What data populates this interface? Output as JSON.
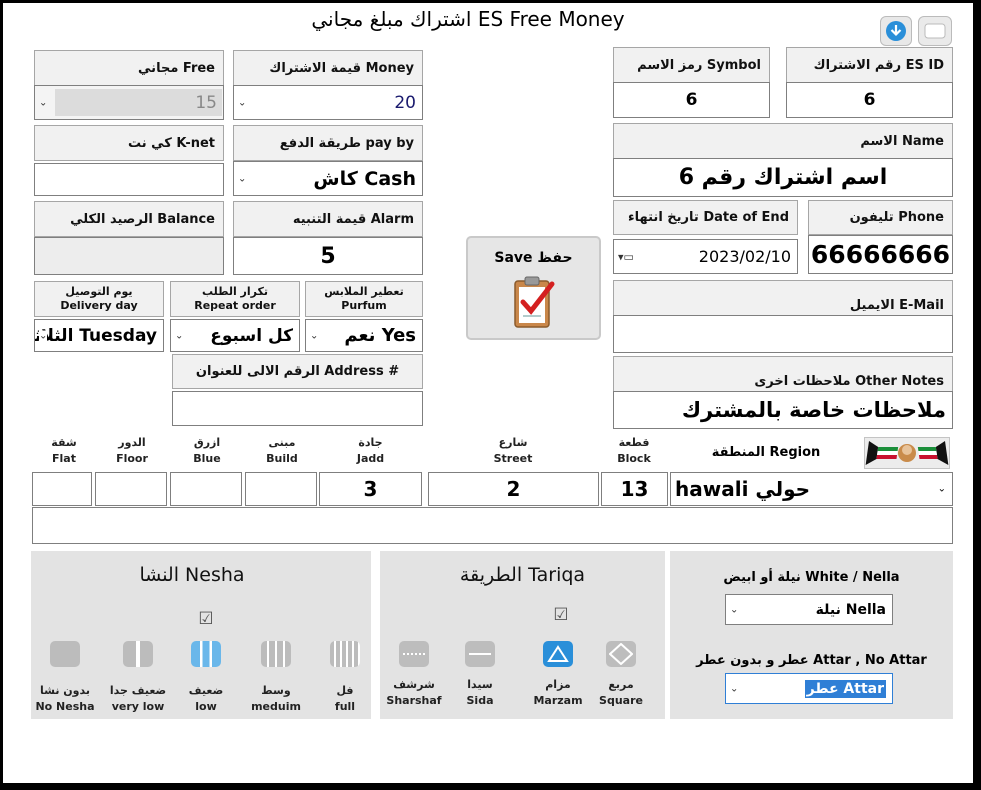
{
  "title": "اشتراك مبلغ مجاني  ES Free Money",
  "fields": {
    "es_id": {
      "label": "رقم الاشتراك ES ID",
      "value": "6"
    },
    "symbol": {
      "label": "رمز الاسم Symbol",
      "value": "6"
    },
    "money": {
      "label": "قيمة الاشتراك  Money",
      "value": "20"
    },
    "free": {
      "label": "مجاني Free",
      "value": "15"
    },
    "name": {
      "label": "الاسم  Name",
      "value": "اسم اشتراك رقم 6"
    },
    "pay_by": {
      "label": "طريقة الدفع pay by",
      "value": "كاش Cash"
    },
    "knet": {
      "label": "كي نت K-net",
      "value": ""
    },
    "phone": {
      "label": "تليفون  Phone",
      "value": "66666666"
    },
    "date_end": {
      "label": "تاريخ انتهاء Date of End",
      "value": "2023/02/10"
    },
    "alarm": {
      "label": "قيمة التنبيه Alarm",
      "value": "5"
    },
    "balance": {
      "label": "الرصيد الكلي Balance",
      "value": ""
    },
    "email": {
      "label": "الايميل E-Mail",
      "value": ""
    },
    "purfum": {
      "label_ar": "تعطير الملابس",
      "label_en": "Purfum",
      "value": "نعم Yes"
    },
    "repeat": {
      "label_ar": "تكرار الطلب",
      "label_en": "Repeat order",
      "value": "كل اسبوع"
    },
    "delivery": {
      "label_ar": "يوم التوصيل",
      "label_en": "Delivery day",
      "value": "الثلاثاء Tuesday"
    },
    "address_no": {
      "label": "الرقم الالى للعنوان  Address #",
      "value": ""
    },
    "notes": {
      "label": "ملاحظات اخرى Other Notes",
      "value": "ملاحظات خاصة بالمشترك"
    }
  },
  "save": {
    "label": "Save  حفظ"
  },
  "address": {
    "region": {
      "label": "المنطقة  Region",
      "value": "hawali حولي"
    },
    "block": {
      "ar": "قطعة",
      "en": "Block",
      "value": "13"
    },
    "street": {
      "ar": "شارع",
      "en": "Street",
      "value": "2"
    },
    "jadd": {
      "ar": "جادة",
      "en": "Jadd",
      "value": "3"
    },
    "build": {
      "ar": "مبنى",
      "en": "Build",
      "value": ""
    },
    "blue": {
      "ar": "ازرق",
      "en": "Blue",
      "value": ""
    },
    "floor": {
      "ar": "الدور",
      "en": "Floor",
      "value": ""
    },
    "flat": {
      "ar": "شقة",
      "en": "Flat",
      "value": ""
    },
    "extra": ""
  },
  "nella_panel": {
    "q1": "نيلة أو ابيض White / Nella",
    "v1": "نيلة Nella",
    "q2": "عطر و بدون عطر Attar , No Attar",
    "v2": "عطر Attar"
  },
  "tariqa": {
    "title": "الطريقة Tariqa",
    "options": [
      {
        "ar": "شرشف",
        "en": "Sharshaf"
      },
      {
        "ar": "سيدا",
        "en": "Sida"
      },
      {
        "ar": "مزام",
        "en": "Marzam"
      },
      {
        "ar": "مربع",
        "en": "Square"
      }
    ],
    "selected": "Marzam"
  },
  "nesha": {
    "title": "النشا Nesha",
    "options": [
      {
        "ar": "بدون نشا",
        "en": "No Nesha"
      },
      {
        "ar": "ضعيف جدا",
        "en": "very low"
      },
      {
        "ar": "ضعيف",
        "en": "low"
      },
      {
        "ar": "وسط",
        "en": "meduim"
      },
      {
        "ar": "فل",
        "en": "full"
      }
    ],
    "selected": "low"
  },
  "colors": {
    "accent": "#2a8fd9",
    "selection": "#2f7fd6",
    "panel": "#e3e3e3"
  }
}
